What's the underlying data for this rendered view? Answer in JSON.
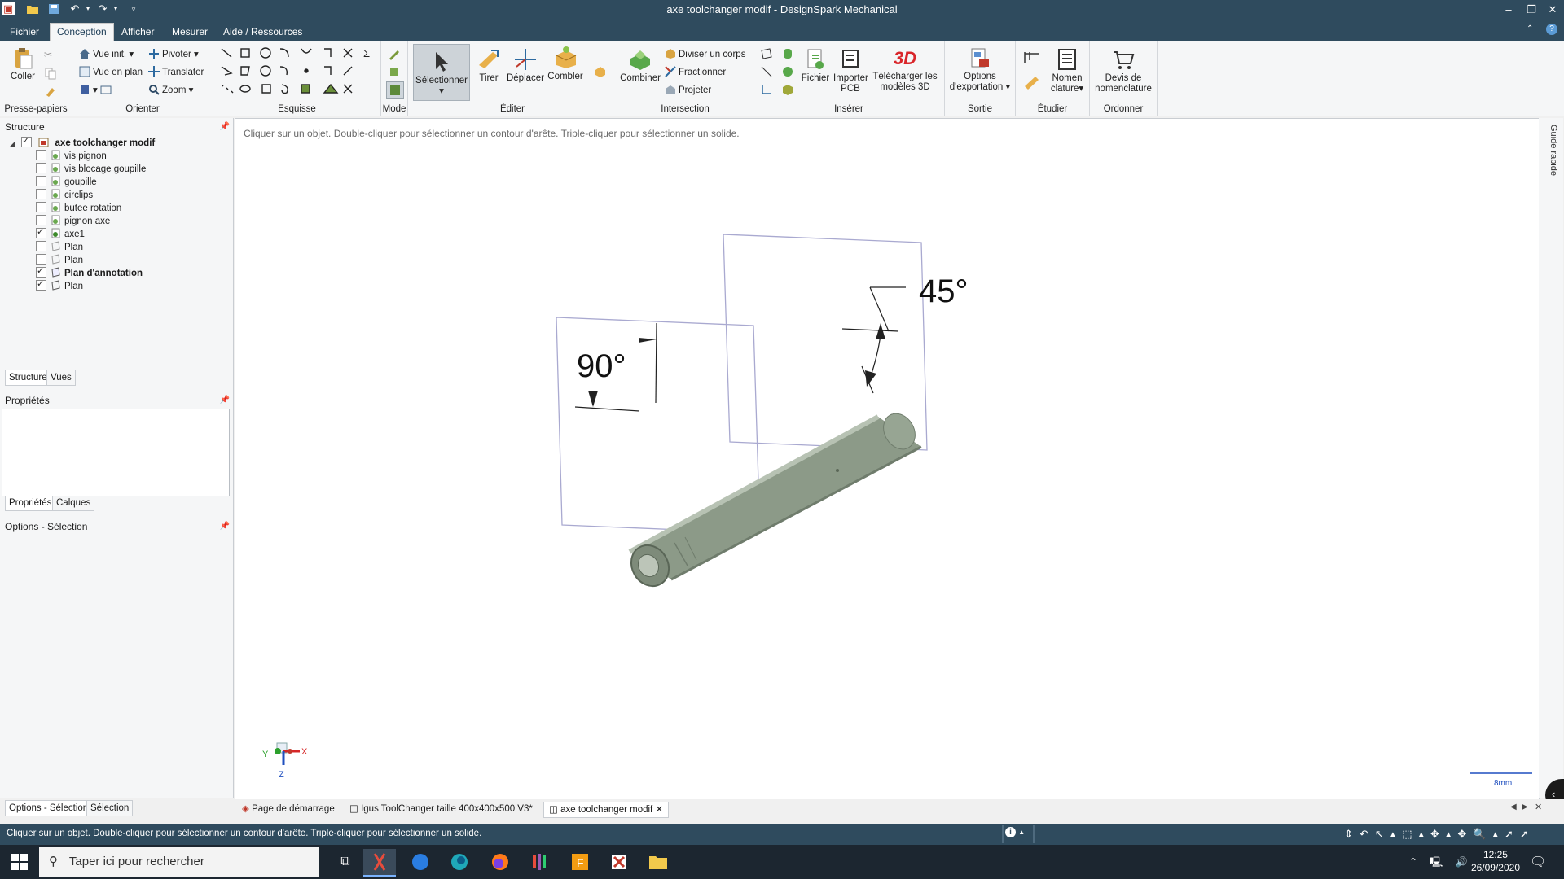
{
  "window": {
    "title": "axe toolchanger modif - DesignSpark Mechanical",
    "controls": [
      "–",
      "❐",
      "✕"
    ]
  },
  "menu": {
    "tabs": [
      "Fichier",
      "Conception",
      "Afficher",
      "Mesurer",
      "Aide / Ressources"
    ],
    "active": "Conception"
  },
  "ribbon": {
    "clipboard": {
      "paste": "Coller",
      "label": "Presse-papiers"
    },
    "orient": {
      "vue_init": "Vue init.",
      "pivoter": "Pivoter",
      "vue_en_plan": "Vue en plan",
      "translater": "Translater",
      "zoom": "Zoom",
      "label": "Orienter"
    },
    "sketch": {
      "label": "Esquisse"
    },
    "mode": {
      "label": "Mode"
    },
    "edit": {
      "select": "Sélectionner",
      "pull": "Tirer",
      "move": "Déplacer",
      "fill": "Combler",
      "label": "Éditer"
    },
    "intersect": {
      "combine": "Combiner",
      "split_body": "Diviser un corps",
      "split": "Fractionner",
      "project": "Projeter",
      "label": "Intersection"
    },
    "insert": {
      "file": "Fichier",
      "import_pcb_1": "Importer",
      "import_pcb_2": "PCB",
      "download_1": "Télécharger les",
      "download_2": "modèles 3D",
      "label": "Insérer"
    },
    "output": {
      "options_1": "Options",
      "options_2": "d'exportation",
      "label": "Sortie"
    },
    "study": {
      "bom_1": "Nomen",
      "bom_2": "clature",
      "label": "Étudier"
    },
    "order": {
      "quote_1": "Devis de",
      "quote_2": "nomenclature",
      "label": "Ordonner"
    }
  },
  "structure": {
    "header": "Structure",
    "root": "axe toolchanger modif",
    "items": [
      {
        "label": "vis pignon",
        "checked": false
      },
      {
        "label": "vis blocage goupille",
        "checked": false
      },
      {
        "label": "goupille",
        "checked": false
      },
      {
        "label": "circlips",
        "checked": false
      },
      {
        "label": "butee rotation",
        "checked": false
      },
      {
        "label": "pignon axe",
        "checked": false
      },
      {
        "label": "axe1",
        "checked": true
      },
      {
        "label": "Plan",
        "checked": false
      },
      {
        "label": "Plan",
        "checked": false
      },
      {
        "label": "Plan d'annotation",
        "checked": true
      },
      {
        "label": "Plan",
        "checked": true
      }
    ],
    "tabs": [
      "Structure",
      "Vues"
    ]
  },
  "properties": {
    "header": "Propriétés",
    "tabs": [
      "Propriétés",
      "Calques"
    ]
  },
  "options": {
    "header": "Options - Sélection",
    "tabs": [
      "Options - Sélection",
      "Sélection"
    ]
  },
  "viewport": {
    "hint": "Cliquer sur un objet. Double-cliquer pour sélectionner un contour d'arête. Triple-cliquer pour sélectionner un solide.",
    "dim_90": "90°",
    "dim_45": "45°",
    "axis_x": "X",
    "axis_y": "Y",
    "axis_z": "Z",
    "scale": "8mm",
    "side_tab": "Guide rapide"
  },
  "doc_tabs": [
    {
      "label": "Page de démarrage",
      "active": false
    },
    {
      "label": "Igus ToolChanger  taille 400x400x500 V3*",
      "active": false
    },
    {
      "label": "axe toolchanger modif",
      "active": true
    }
  ],
  "statusbar": {
    "text": "Cliquer sur un objet. Double-cliquer pour sélectionner un contour d'arête. Triple-cliquer pour sélectionner un solide."
  },
  "taskbar": {
    "search_placeholder": "Taper ici pour rechercher",
    "time": "12:25",
    "date": "26/09/2020"
  },
  "colors": {
    "chrome": "#2f4b5e",
    "ribbon": "#f5f6f7",
    "part": "#8c9a88",
    "plane": "#a9a9d0"
  }
}
